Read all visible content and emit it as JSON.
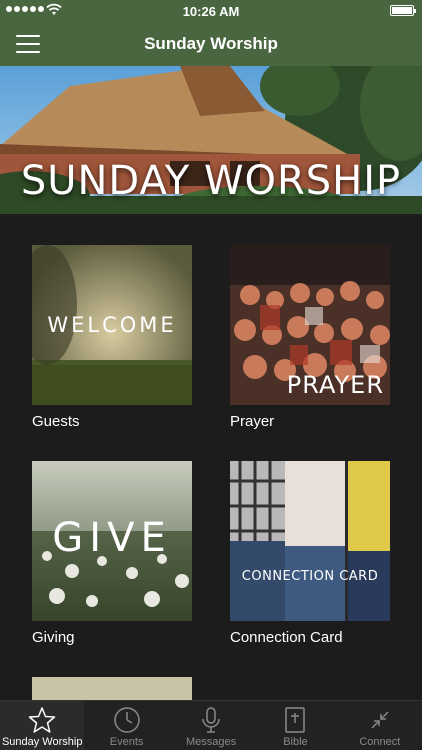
{
  "status": {
    "time": "10:26 AM"
  },
  "nav": {
    "title": "Sunday Worship"
  },
  "hero": {
    "title": "SUNDAY WORSHIP"
  },
  "tiles": [
    {
      "overlay": "WELCOME",
      "caption": "Guests"
    },
    {
      "overlay": "PRAYER",
      "caption": "Prayer"
    },
    {
      "overlay": "GIVE",
      "caption": "Giving"
    },
    {
      "overlay": "CONNECTION CARD",
      "caption": "Connection Card"
    }
  ],
  "tabs": [
    {
      "label": "Sunday Worship",
      "icon": "star-icon",
      "active": true
    },
    {
      "label": "Events",
      "icon": "clock-icon",
      "active": false
    },
    {
      "label": "Messages",
      "icon": "microphone-icon",
      "active": false
    },
    {
      "label": "Bible",
      "icon": "bible-icon",
      "active": false
    },
    {
      "label": "Connect",
      "icon": "collapse-arrows-icon",
      "active": false
    }
  ],
  "colors": {
    "brand": "#4a6640",
    "background": "#1c1c1c",
    "tabbar": "#222222"
  }
}
